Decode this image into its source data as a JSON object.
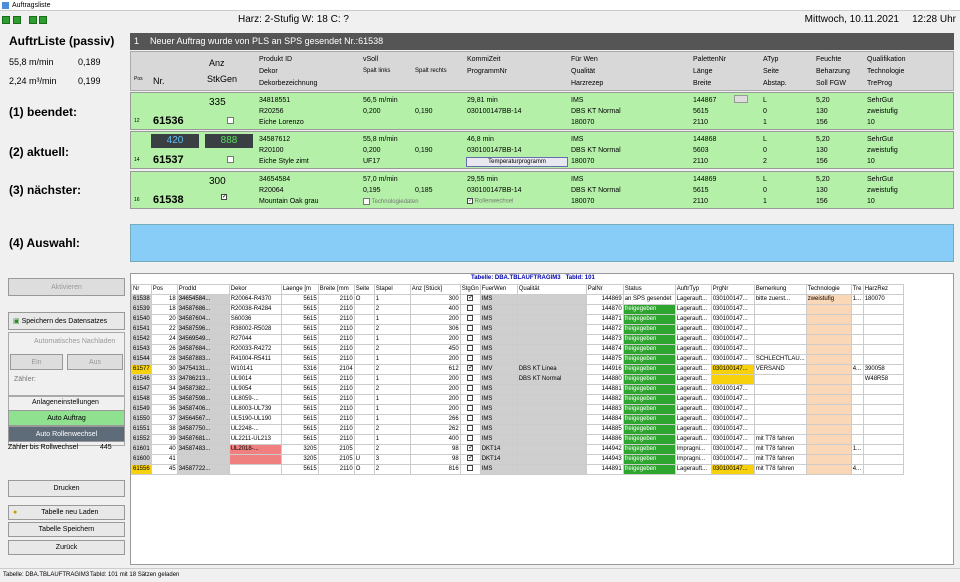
{
  "window": {
    "title": "Auftragsliste"
  },
  "header": {
    "center": "Harz: 2-Stufig W: 18 C: ?",
    "date": "Mittwoch, 10.11.2021",
    "time": "12:28 Uhr"
  },
  "left": {
    "title": "AuftrListe (passiv)",
    "speed1": "55,8 m/min",
    "speed1_val": "0,189",
    "speed2": "2,24 m³/min",
    "speed2_val": "0,199",
    "lbl_beendet": "(1) beendet:",
    "lbl_aktuell": "(2) aktuell:",
    "lbl_naechster": "(3) nächster:",
    "lbl_auswahl": "(4) Auswahl:",
    "btn_aktivieren": "Aktivieren",
    "btn_speichern_datensatz": "Speichern des Datensatzes",
    "auto_nachladen": "Automatisches Nachladen",
    "btn_ein": "Ein",
    "btn_aus": "Aus",
    "zaehler": "Zähler:",
    "anlageneinstellungen": "Anlageneinstellungen",
    "btn_auto_auftrag": "Auto Auftrag",
    "btn_auto_rollenwechsel": "Auto Rollenwechsel",
    "zaehler_rollwechsel": "Zähler bis Rollwechsel",
    "zaehler_rollwechsel_val": "445",
    "btn_drucken": "Drucken",
    "btn_tabelle_neu": "Tabelle neu Laden",
    "btn_tabelle_speichern": "Tabelle Speichern",
    "btn_zurueck": "Zurück"
  },
  "message": {
    "num": "1",
    "text": "Neuer Auftrag wurde von PLS an SPS gesendet Nr.:61538"
  },
  "gridhdr": {
    "pos": "Pos",
    "nr": "Nr.",
    "anz": "Anz",
    "stkgen": "StkGen",
    "c1": [
      "Produkt ID",
      "Dekor",
      "Dekorbezeichnung"
    ],
    "c2": [
      "vSoll",
      "Spalt links",
      "Spalt rechts"
    ],
    "c3": [
      "KommiZeit",
      "ProgrammNr"
    ],
    "c4": [
      "Für Wen",
      "Qualität",
      "Harzrezep"
    ],
    "c5": [
      "PalettenNr",
      "Länge",
      "Breite"
    ],
    "c6": [
      "ATyp",
      "Seite",
      "Abstap."
    ],
    "c7": [
      "Feuchte",
      "Beharzung",
      "Soll FGW"
    ],
    "c8": [
      "Qualifikation",
      "Technologie",
      "TreProg"
    ]
  },
  "rows": {
    "beendet": {
      "pos": "12",
      "nr": "61536",
      "anz": "335",
      "c1": [
        "34818551",
        "R20256",
        "Eiche Lorenzo"
      ],
      "c2": [
        "56,5 m/min",
        "0,200",
        "0,190"
      ],
      "c3": [
        "29,81 min",
        "030100147BB-14"
      ],
      "c4": [
        "IMS",
        "DBS KT Normal",
        "180070"
      ],
      "c5": [
        "144867",
        "5615",
        "2110"
      ],
      "c6": [
        "L",
        "0",
        "1"
      ],
      "c7": [
        "5,20",
        "130",
        "156"
      ],
      "c8": [
        "SehrGut",
        "zweistufig",
        "10"
      ]
    },
    "aktuell": {
      "pos": "14",
      "nr": "61537",
      "count1": "420",
      "count2": "888",
      "c1": [
        "34587612",
        "R20100",
        "Eiche Style zimt"
      ],
      "c2": [
        "55,8 m/min",
        "0,200",
        "0,190"
      ],
      "c3": [
        "46,8 min",
        "030100147BB-14"
      ],
      "btn": "Temperaturprogramm",
      "c4": [
        "IMS",
        "DBS KT Normal",
        "180070"
      ],
      "c5": [
        "144868",
        "5603",
        "2110"
      ],
      "c6": [
        "L",
        "0",
        "2"
      ],
      "c7": [
        "5,20",
        "130",
        "156"
      ],
      "c8": [
        "SehrGut",
        "zweistufig",
        "10"
      ],
      "uf": "UF17"
    },
    "naechster": {
      "pos": "16",
      "nr": "61538",
      "anz": "300",
      "c1": [
        "34654584",
        "R20064",
        "Mountain Oak grau"
      ],
      "c2": [
        "57,0 m/min",
        "0,195",
        "0,185"
      ],
      "c3": [
        "29,55 min",
        "030100147BB-14"
      ],
      "c4": [
        "IMS",
        "DBS KT Normal",
        "180070"
      ],
      "c5": [
        "144869",
        "5615",
        "2110"
      ],
      "c6": [
        "L",
        "0",
        "1"
      ],
      "c7": [
        "5,20",
        "130",
        "156"
      ],
      "c8": [
        "SehrGut",
        "zweistufig",
        "10"
      ],
      "tech": "Technologiedaten",
      "rw": "Rollenwechsel"
    }
  },
  "table": {
    "title": "Tabelle: DBA.TBLAUFTRAGIM3",
    "tabid": "TabId: 101",
    "headers": [
      "Nr",
      "Pos",
      "ProdId",
      "Dekor",
      "Laenge [m",
      "Breite [mm",
      "Seite",
      "Stapel",
      "Anz [Stück]",
      "StgGn",
      "FuerWen",
      "Qualität",
      "PalNr",
      "Status",
      "AuftrTyp",
      "PrgNr",
      "Bemerkung",
      "Technologie",
      "Tre",
      "HarzRez"
    ],
    "rows": [
      [
        "61538",
        "18",
        "34654584...",
        "R20064-R4370",
        "5615",
        "2110",
        "O",
        "1",
        "300",
        "1",
        "IMS",
        "",
        "144869",
        "an SPS gesendet",
        "Lagerauft...",
        "030100147...",
        "bitte zuerst...",
        "zweistufig",
        "1...",
        "180070"
      ],
      [
        "61539",
        "18",
        "34587686...",
        "R20038-R4284",
        "5615",
        "2110",
        "",
        "2",
        "400",
        "0",
        "IMS",
        "",
        "144870",
        "freigegeben",
        "Lagerauft...",
        "030100147...",
        "",
        "",
        "",
        ""
      ],
      [
        "61540",
        "20",
        "34587604...",
        "S60036",
        "5615",
        "2110",
        "",
        "1",
        "200",
        "0",
        "IMS",
        "",
        "144871",
        "freigegeben",
        "Lagerauft...",
        "030100147...",
        "",
        "",
        "",
        ""
      ],
      [
        "61541",
        "22",
        "34587596...",
        "R38002-R5028",
        "5615",
        "2110",
        "",
        "2",
        "306",
        "0",
        "IMS",
        "",
        "144872",
        "freigegeben",
        "Lagerauft...",
        "030100147...",
        "",
        "",
        "",
        ""
      ],
      [
        "61542",
        "24",
        "34569549...",
        "R27044",
        "5615",
        "2110",
        "",
        "1",
        "200",
        "0",
        "IMS",
        "",
        "144873",
        "freigegeben",
        "Lagerauft...",
        "030100147...",
        "",
        "",
        "",
        ""
      ],
      [
        "61543",
        "26",
        "34587684...",
        "R20033-R4272",
        "5615",
        "2110",
        "",
        "2",
        "450",
        "0",
        "IMS",
        "",
        "144874",
        "freigegeben",
        "Lagerauft...",
        "030100147...",
        "",
        "",
        "",
        ""
      ],
      [
        "61544",
        "28",
        "34587883...",
        "R41004-R5411",
        "5615",
        "2110",
        "",
        "1",
        "200",
        "0",
        "IMS",
        "",
        "144875",
        "freigegeben",
        "Lagerauft...",
        "030100147...",
        "SCHLECHTLAU...",
        "",
        "",
        ""
      ],
      [
        "61577",
        "30",
        "34754131...",
        "W10141",
        "5316",
        "2104",
        "",
        "2",
        "612",
        "1",
        "IMV",
        "DBS KT Linea",
        "144916",
        "freigegeben",
        "Lagerauft...",
        "030100147...",
        "VERSAND",
        "",
        "4...",
        "390058"
      ],
      [
        "61546",
        "33",
        "34786213...",
        "UL9014",
        "5615",
        "2110",
        "",
        "1",
        "200",
        "0",
        "IMS",
        "DBS KT Normal",
        "144880",
        "freigegeben",
        "Lagerauft...",
        "",
        "",
        "",
        "",
        "W48R58"
      ],
      [
        "61547",
        "34",
        "34587382...",
        "UL9054",
        "5615",
        "2110",
        "",
        "2",
        "200",
        "0",
        "IMS",
        "",
        "144881",
        "freigegeben",
        "Lagerauft...",
        "030100147...",
        "",
        "",
        "",
        ""
      ],
      [
        "61548",
        "35",
        "34587598...",
        "UL8059-...",
        "5615",
        "2110",
        "",
        "1",
        "200",
        "0",
        "IMS",
        "",
        "144882",
        "freigegeben",
        "Lagerauft...",
        "030100147...",
        "",
        "",
        "",
        ""
      ],
      [
        "61549",
        "36",
        "34587406...",
        "UL8003-UL739",
        "5615",
        "2110",
        "",
        "1",
        "200",
        "0",
        "IMS",
        "",
        "144883",
        "freigegeben",
        "Lagerauft...",
        "030100147...",
        "",
        "",
        "",
        ""
      ],
      [
        "61550",
        "37",
        "34564567...",
        "UL5190-UL190",
        "5615",
        "2110",
        "",
        "1",
        "266",
        "0",
        "IMS",
        "",
        "144884",
        "freigegeben",
        "Lagerauft...",
        "030100147...",
        "",
        "",
        "",
        ""
      ],
      [
        "61551",
        "38",
        "34587750...",
        "UL2248-...",
        "5615",
        "2110",
        "",
        "2",
        "262",
        "0",
        "IMS",
        "",
        "144885",
        "freigegeben",
        "Lagerauft...",
        "030100147...",
        "",
        "",
        "",
        ""
      ],
      [
        "61552",
        "39",
        "34587681...",
        "UL2211-UL213",
        "5615",
        "2110",
        "",
        "1",
        "400",
        "0",
        "IMS",
        "",
        "144886",
        "freigegeben",
        "Lagerauft...",
        "030100147...",
        "mit T78 fahren",
        "",
        "",
        ""
      ],
      [
        "61601",
        "40",
        "34587483...",
        "UL2018-...",
        "3205",
        "2105",
        "",
        "2",
        "98",
        "1",
        "DKT14",
        "",
        "144942",
        "freigegeben",
        "Impragni...",
        "030100147...",
        "mit T78 fahren",
        "",
        "1...",
        ""
      ],
      [
        "61600",
        "41",
        "",
        "",
        "3205",
        "2105",
        "U",
        "3",
        "98",
        "1",
        "DKT14",
        "",
        "144943",
        "freigegeben",
        "Impragni...",
        "030100147...",
        "mit T78 fahren",
        "",
        "",
        ""
      ],
      [
        "61556",
        "45",
        "34587722...",
        "",
        "5615",
        "2110",
        "O",
        "2",
        "816",
        "0",
        "IMS",
        "",
        "144891",
        "freigegeben",
        "Lagerauft...",
        "030100147...",
        "mit T78 fahren",
        "",
        "4...",
        ""
      ]
    ]
  },
  "statusbar": {
    "left": "Tabelle: DBA.TBLAUFTRAGIM3",
    "right": "TabId: 101 mit 18 Sätzen geladen"
  }
}
